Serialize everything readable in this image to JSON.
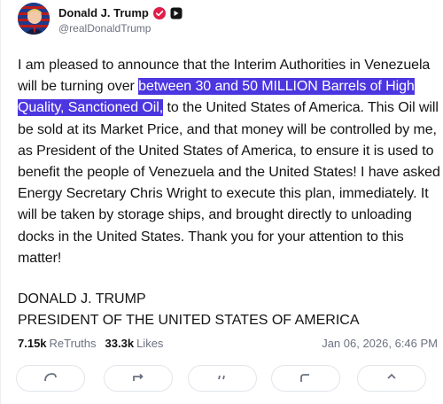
{
  "author": {
    "display_name": "Donald J. Trump",
    "handle": "@realDonaldTrump",
    "verified_icon": "verified-badge-icon",
    "bot_icon": "account-badge-icon"
  },
  "post": {
    "text_before": "I am pleased to announce that the Interim Authorities in Venezuela will be turning over ",
    "text_highlighted": "between 30 and 50 MILLION Barrels of High Quality, Sanctioned Oil,",
    "text_after": " to the United States of America. This Oil will be sold at its Market Price, and that money will be controlled by me, as President of the United States of America, to ensure it is used to benefit the people of Venezuela and the United States! I have asked Energy Secretary Chris Wright to execute this plan, immediately. It will be taken by storage ships, and brought directly to unloading docks in the United States. Thank you for your attention to this matter!",
    "signature_line1": "DONALD J. TRUMP",
    "signature_line2": "PRESIDENT OF THE UNITED STATES OF AMERICA"
  },
  "stats": {
    "retruths_count": "7.15k",
    "retruths_label": "ReTruths",
    "likes_count": "33.3k",
    "likes_label": "Likes",
    "timestamp": "Jan 06, 2026, 6:46 PM"
  },
  "actions": [
    "reply-icon",
    "retruth-icon",
    "quote-icon",
    "like-icon",
    "share-icon"
  ],
  "colors": {
    "highlight": "#4c36e0",
    "verified": "#e11d48",
    "text": "#141414",
    "muted": "#6b7280"
  }
}
